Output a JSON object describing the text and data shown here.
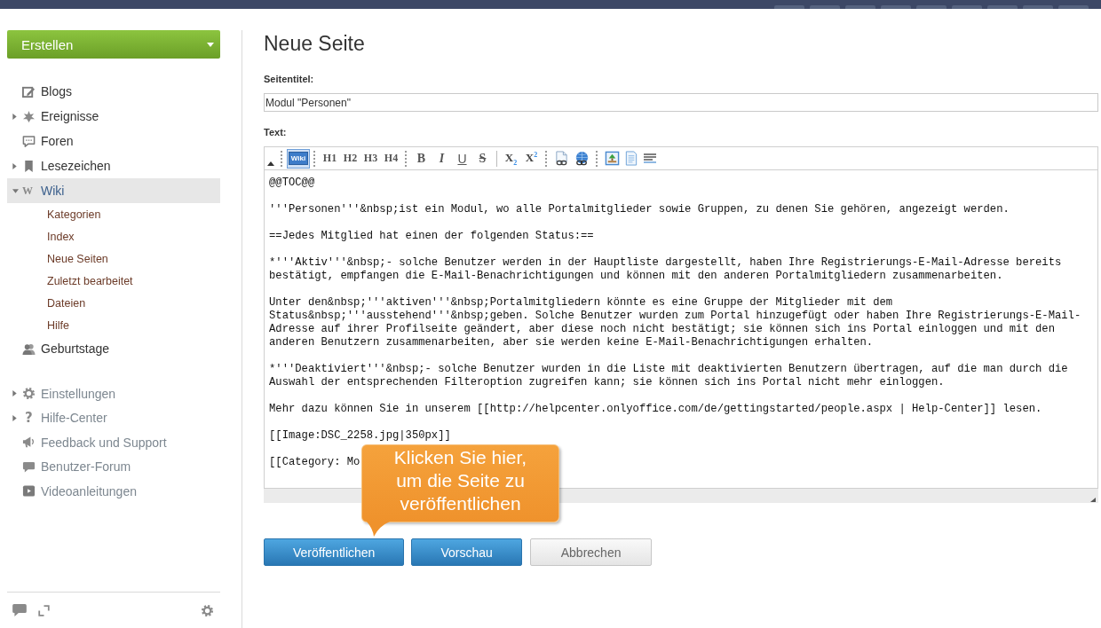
{
  "sidebar": {
    "create_button": {
      "label": "Erstellen"
    },
    "nav": [
      {
        "label": "Blogs",
        "selected": false
      },
      {
        "label": "Ereignisse",
        "selected": false,
        "expanded": false
      },
      {
        "label": "Foren",
        "selected": false
      },
      {
        "label": "Lesezeichen",
        "selected": false,
        "expanded": false
      },
      {
        "label": "Wiki",
        "glyph": "W",
        "selected": true,
        "expanded": true,
        "children": [
          {
            "label": "Kategorien",
            "selected": false
          },
          {
            "label": "Index",
            "selected": false
          },
          {
            "label": "Neue Seiten",
            "selected": false
          },
          {
            "label": "Zuletzt bearbeitet",
            "selected": false
          },
          {
            "label": "Dateien",
            "selected": false
          },
          {
            "label": "Hilfe",
            "selected": false
          }
        ]
      },
      {
        "label": "Geburtstage",
        "selected": false
      }
    ],
    "help_nav": [
      {
        "label": "Einstellungen",
        "expanded": false
      },
      {
        "label": "Hilfe-Center",
        "glyph": "?",
        "expanded": false
      },
      {
        "label": "Feedback und Support"
      },
      {
        "label": "Benutzer-Forum"
      },
      {
        "label": "Videoanleitungen"
      }
    ]
  },
  "page": {
    "title": "Neue Seite",
    "title_label": "Seitentitel:",
    "title_value": "Modul \"Personen\"",
    "text_label": "Text:"
  },
  "editor": {
    "toolbar": {
      "groups": [
        {
          "buttons": [
            {
              "kind": "mode",
              "label": "Wiki",
              "selected": true
            }
          ]
        },
        {
          "buttons": [
            {
              "kind": "heading",
              "label": "H1",
              "selected": false
            },
            {
              "kind": "heading",
              "label": "H2",
              "selected": false
            },
            {
              "kind": "heading",
              "label": "H3",
              "selected": false
            },
            {
              "kind": "heading",
              "label": "H4",
              "selected": false
            }
          ]
        },
        {
          "buttons": [
            {
              "kind": "bold",
              "label": "B",
              "selected": false
            },
            {
              "kind": "italic",
              "label": "I",
              "selected": false
            },
            {
              "kind": "underline",
              "label": "U",
              "selected": false
            },
            {
              "kind": "strike",
              "label": "S",
              "selected": false
            },
            {
              "kind": "script",
              "label": "X$_{2}$",
              "selected": false
            },
            {
              "kind": "script",
              "label": "X$^{2}$",
              "selected": false
            }
          ]
        }
      ]
    },
    "paragraphs": [
      "@@TOC@@",
      "'''Personen'''&nbsp;ist ein Modul, wo alle Portalmitglieder sowie Gruppen, zu denen Sie gehören, angezeigt werden.",
      "==Jedes Mitglied hat einen der folgenden Status:==",
      "*'''Aktiv'''&nbsp;- solche Benutzer werden in der Hauptliste dargestellt, haben Ihre Registrierungs-E-Mail-Adresse bereits bestätigt, empfangen die E-Mail-Benachrichtigungen und können mit den anderen Portalmitgliedern zusammenarbeiten.",
      "Unter den&nbsp;'''aktiven'''&nbsp;Portalmitgliedern könnte es eine Gruppe der Mitglieder mit dem Status&nbsp;'''ausstehend'''&nbsp;geben. Solche Benutzer wurden zum Portal hinzugefügt oder haben Ihre Registrierungs-E-Mail-Adresse auf ihrer Profilseite geändert, aber diese noch nicht bestätigt; sie können sich ins Portal einloggen und mit den anderen Benutzern zusammenarbeiten, aber sie werden keine E-Mail-Benachrichtigungen erhalten.",
      "*'''Deaktiviert'''&nbsp;- solche Benutzer wurden in die Liste mit deaktivierten Benutzern übertragen, auf die man durch die Auswahl der entsprechenden Filteroption zugreifen kann; sie können sich ins Portal nicht mehr einloggen.",
      "Mehr dazu können Sie in unserem [[http://helpcenter.onlyoffice.com/de/gettingstarted/people.aspx | Help-Center]] lesen.",
      "[[Image:DSC_2258.jpg|350px]]",
      "[[Category: Mo"
    ]
  },
  "actions": [
    {
      "label": "Veröffentlichen",
      "kind": "primary"
    },
    {
      "label": "Vorschau",
      "kind": "primary"
    },
    {
      "label": "Abbrechen",
      "kind": "secondary"
    }
  ],
  "callout": {
    "text": "Klicken Sie hier, um die Seite zu veröffentlichen"
  }
}
